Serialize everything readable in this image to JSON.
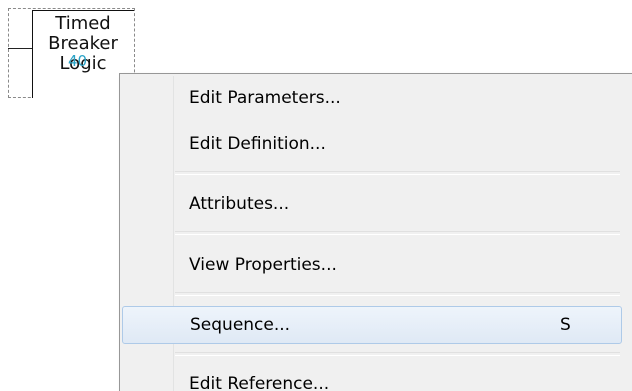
{
  "schematic_block": {
    "label_lines": [
      "Timed",
      "Breaker",
      "Logic"
    ],
    "number": "40",
    "number_color": "#2aa3c7"
  },
  "context_menu": {
    "items": [
      {
        "label": "Edit Parameters..."
      },
      {
        "label": "Edit Definition..."
      },
      {
        "label": "Attributes..."
      },
      {
        "label": "View Properties..."
      },
      {
        "label": "Sequence...",
        "shortcut": "S",
        "highlighted": true
      },
      {
        "label": "Edit Reference..."
      }
    ],
    "highlight_color": "#dfe9f5",
    "background_color": "#f0f0f0"
  }
}
